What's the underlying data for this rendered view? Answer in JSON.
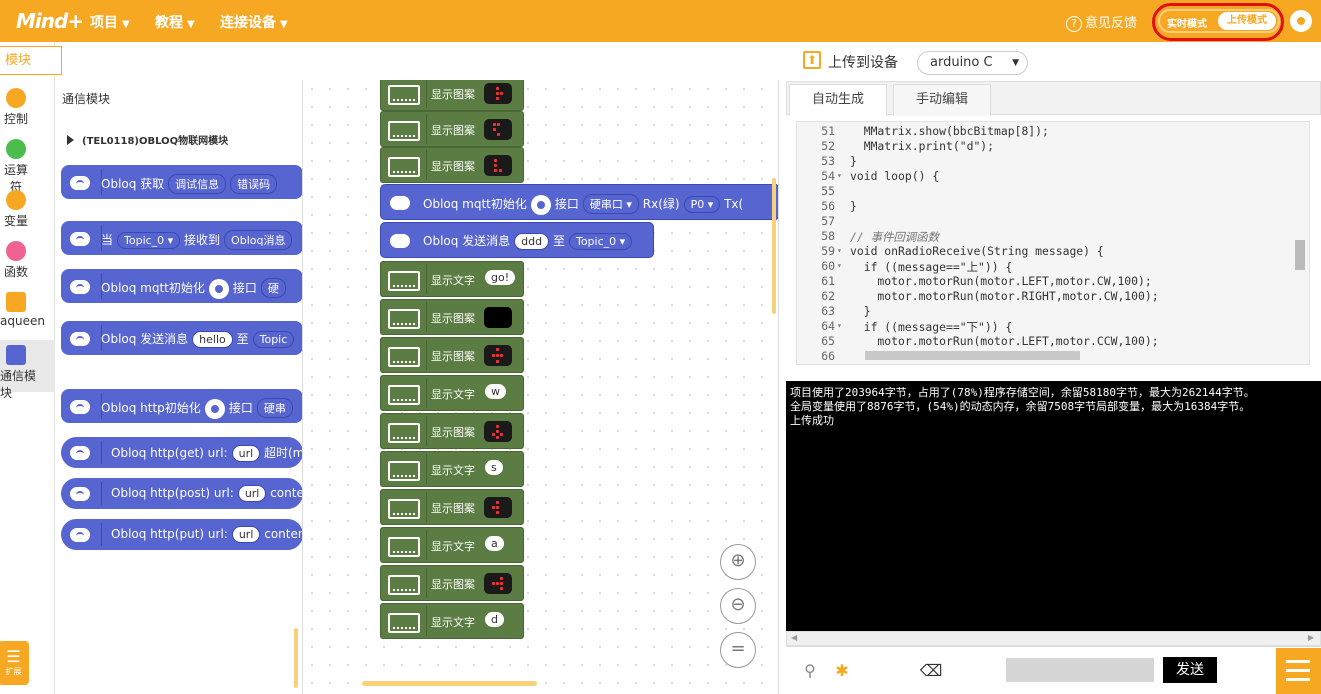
{
  "header": {
    "logo_text": "Mind+",
    "menus": [
      "项目",
      "教程",
      "连接设备"
    ],
    "feedback": "意见反馈",
    "mode_realtime": "实时模式",
    "mode_upload": "上传模式"
  },
  "sidebar": {
    "modules_button": "模块",
    "categories": [
      {
        "label": "控制",
        "color": "#f7a823"
      },
      {
        "label": "运算符",
        "color": "#4cbc4c"
      },
      {
        "label": "变量",
        "color": "#f7a823"
      },
      {
        "label": "函数",
        "color": "#f06292"
      },
      {
        "label": "aqueen",
        "color": "#f7a823"
      },
      {
        "label": "通信模块",
        "color": "#5765d0"
      }
    ]
  },
  "flyout": {
    "title": "通信模块",
    "subtitle": "(TEL0118)OBLOQ物联网模块",
    "blocks": [
      {
        "label": "Obloq 获取",
        "pills": [
          "调试信息",
          "错误码"
        ]
      },
      {
        "label": "当",
        "pills": [
          "Topic_0 ▾",
          "接收到",
          "Obloq消息"
        ]
      },
      {
        "label": "Obloq mqtt初始化",
        "pills": [
          "接口",
          "硬"
        ]
      },
      {
        "label": "Obloq 发送消息",
        "pills": [
          "hello",
          "至",
          "Topic"
        ]
      },
      {
        "label": "Obloq http初始化",
        "pills": [
          "接口",
          "硬串"
        ]
      },
      {
        "label": "Obloq http(get) url:",
        "pills": [
          "url",
          "超时(m"
        ]
      },
      {
        "label": "Obloq http(post) url:",
        "pills": [
          "url",
          "conte"
        ]
      },
      {
        "label": "Obloq http(put) url:",
        "pills": [
          "url",
          "conten"
        ]
      }
    ]
  },
  "workspace": {
    "show_pattern": "显示图案",
    "show_text": "显示文字",
    "mqtt_block": {
      "label": "Obloq mqtt初始化",
      "port_label": "接口",
      "port_value": "硬串口 ▾",
      "rx_label": "Rx(绿)",
      "rx_value": "P0 ▾",
      "tx_label": "Tx("
    },
    "send_block": {
      "label": "Obloq 发送消息",
      "msg": "ddd",
      "to": "至",
      "topic": "Topic_0 ▾"
    },
    "texts": [
      "go!",
      "w",
      "s",
      "a",
      "d"
    ],
    "zoom_in": "⊕",
    "zoom_out": "⊖",
    "zoom_reset": "="
  },
  "right_panel": {
    "upload_label": "上传到设备",
    "board": "arduino C",
    "tabs": [
      "自动生成",
      "手动编辑"
    ],
    "code_lines": [
      {
        "n": "51",
        "fold": "",
        "text": "  MMatrix.show(bbcBitmap[8]);"
      },
      {
        "n": "52",
        "fold": "",
        "text": "  MMatrix.print(\"d\");"
      },
      {
        "n": "53",
        "fold": "",
        "text": "}"
      },
      {
        "n": "54",
        "fold": "▾",
        "text": "void loop() {"
      },
      {
        "n": "55",
        "fold": "",
        "text": ""
      },
      {
        "n": "56",
        "fold": "",
        "text": "}"
      },
      {
        "n": "57",
        "fold": "",
        "text": ""
      },
      {
        "n": "58",
        "fold": "",
        "text": "// 事件回调函数"
      },
      {
        "n": "59",
        "fold": "▾",
        "text": "void onRadioReceive(String message) {"
      },
      {
        "n": "60",
        "fold": "▾",
        "text": "  if ((message==\"上\")) {"
      },
      {
        "n": "61",
        "fold": "",
        "text": "    motor.motorRun(motor.LEFT,motor.CW,100);"
      },
      {
        "n": "62",
        "fold": "",
        "text": "    motor.motorRun(motor.RIGHT,motor.CW,100);"
      },
      {
        "n": "63",
        "fold": "",
        "text": "  }"
      },
      {
        "n": "64",
        "fold": "▾",
        "text": "  if ((message==\"下\")) {"
      },
      {
        "n": "65",
        "fold": "",
        "text": "    motor.motorRun(motor.LEFT,motor.CCW,100);"
      },
      {
        "n": "66",
        "fold": "",
        "text": ""
      }
    ],
    "console_lines": [
      "项目使用了203964字节，占用了(78%)程序存储空间，余留58180字节，最大为262144字节。",
      "全局变量使用了8876字节，(54%)的动态内存，余留7508字节局部变量，最大为16384字节。",
      "上传成功"
    ],
    "send_button": "发送"
  }
}
